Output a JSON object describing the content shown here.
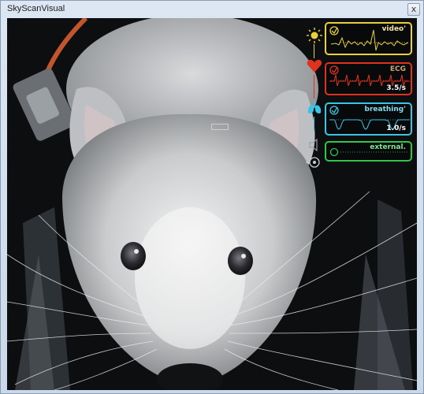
{
  "window": {
    "title": "SkyScanVisual",
    "close_glyph": "x"
  },
  "monitor": {
    "video": {
      "label": "video'",
      "icon": "sun-icon",
      "color": "#e8d13a"
    },
    "ecg": {
      "label": "ECG",
      "rate": "3.5/s",
      "icon": "heart-icon",
      "color": "#e0331f"
    },
    "breathing": {
      "label": "breathing'",
      "rate": "1.0/s",
      "icon": "lungs-icon",
      "color": "#39c6e6"
    },
    "external": {
      "label": "external.",
      "color": "#2fc64a"
    }
  },
  "side_icons": {
    "speaker": "speaker-icon",
    "target": "target-icon"
  }
}
